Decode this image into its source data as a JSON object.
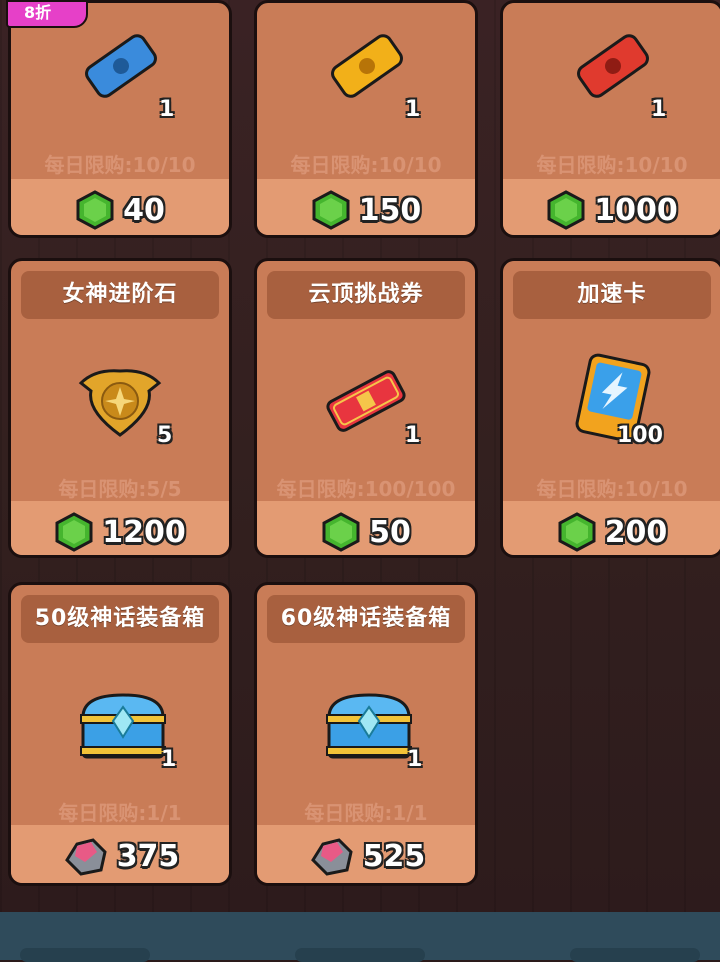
{
  "discount_badge": "8折",
  "colors": {
    "card": "#c97c57",
    "name_band": "#a8603f",
    "price_band": "#e39b73",
    "limit_text": "#d99373",
    "gem": "#45b52e",
    "bottom_bar": "#2f4b5b"
  },
  "row1": [
    {
      "qty": "1",
      "limit": "每日限购:10/10",
      "price": "40",
      "icon": "blue-ticket-icon"
    },
    {
      "qty": "1",
      "limit": "每日限购:10/10",
      "price": "150",
      "icon": "gold-ticket-icon"
    },
    {
      "qty": "1",
      "limit": "每日限购:10/10",
      "price": "1000",
      "icon": "red-ticket-icon"
    }
  ],
  "row2": [
    {
      "name": "女神进阶石",
      "qty": "5",
      "limit": "每日限购:5/5",
      "price": "1200",
      "icon": "goddess-stone-icon"
    },
    {
      "name": "云顶挑战券",
      "qty": "1",
      "limit": "每日限购:100/100",
      "price": "50",
      "icon": "challenge-ticket-icon"
    },
    {
      "name": "加速卡",
      "qty": "100",
      "limit": "每日限购:10/10",
      "price": "200",
      "icon": "speed-card-icon"
    }
  ],
  "row3": [
    {
      "name": "50级神话装备箱",
      "qty": "1",
      "limit": "每日限购:1/1",
      "price": "375",
      "icon": "treasure-chest-icon"
    },
    {
      "name": "60级神话装备箱",
      "qty": "1",
      "limit": "每日限购:1/1",
      "price": "525",
      "icon": "treasure-chest-icon"
    }
  ]
}
